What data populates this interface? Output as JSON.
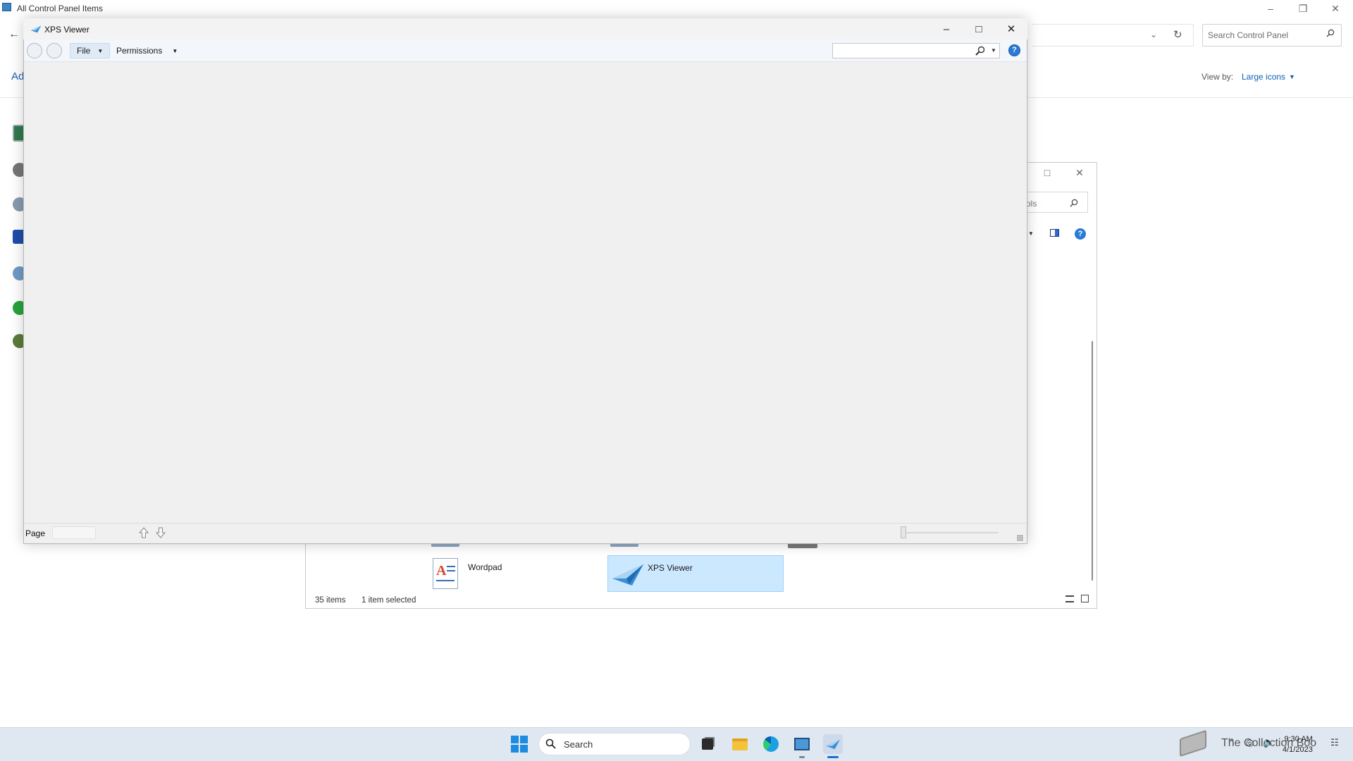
{
  "control_panel": {
    "title": "All Control Panel Items",
    "search_placeholder": "Search Control Panel",
    "view_by_label": "View by:",
    "view_by_value": "Large icons",
    "adjust_partial": "Ad"
  },
  "admin_tools": {
    "search_partial": "ols",
    "status_count": "35 items",
    "status_selection": "1 item selected",
    "items": [
      {
        "label": "Wordpad"
      },
      {
        "label": "XPS Viewer"
      }
    ]
  },
  "xps_viewer": {
    "title": "XPS Viewer",
    "menu": {
      "file": "File",
      "permissions": "Permissions"
    },
    "find_value": "",
    "page_label": "Page",
    "page_value": ""
  },
  "taskbar": {
    "search_label": "Search",
    "widget_text": "The Collection Boo",
    "time": "9:30 AM",
    "date": "4/1/2023"
  },
  "colors": {
    "accent": "#0f5fb8",
    "selection": "#cce8ff",
    "help_blue": "#2a7bd4"
  }
}
